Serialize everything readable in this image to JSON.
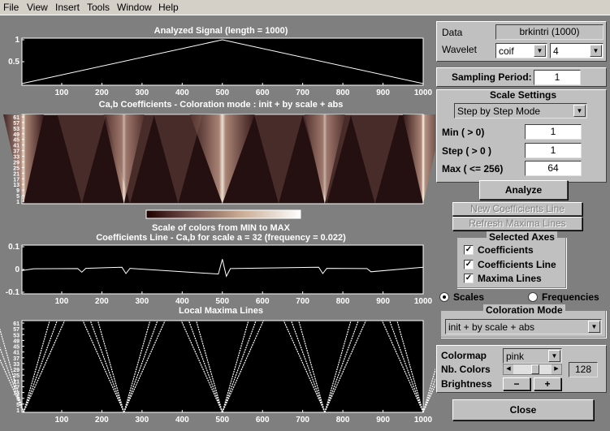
{
  "menu": [
    "File",
    "View",
    "Insert",
    "Tools",
    "Window",
    "Help"
  ],
  "plots": {
    "signal": {
      "title": "Analyzed Signal  (length = 1000)",
      "yticks": [
        "1",
        "0.5"
      ],
      "ytick_values": [
        1,
        0.5
      ],
      "ylim": [
        0,
        1
      ]
    },
    "coef": {
      "title": "Ca,b Coefficients  - Coloration mode : init + by scale + abs",
      "yticks": [
        "61",
        "57",
        "53",
        "49",
        "45",
        "41",
        "37",
        "33",
        "29",
        "25",
        "21",
        "17",
        "13",
        "9",
        "5",
        "1"
      ]
    },
    "colorbar": {
      "title": "Scale of colors from MIN to MAX"
    },
    "line": {
      "title": "Coefficients Line - Ca,b  for scale a = 32  (frequency =   0.022)",
      "yticks": [
        "0.1",
        "0",
        "-0.1"
      ],
      "ytick_values": [
        0.1,
        0,
        -0.1
      ],
      "ylim": [
        -0.1,
        0.1
      ]
    },
    "maxima": {
      "title": "Local Maxima Lines",
      "yticks": [
        "61",
        "57",
        "53",
        "49",
        "45",
        "41",
        "37",
        "33",
        "29",
        "25",
        "21",
        "17",
        "13",
        "9",
        "5",
        "1"
      ]
    },
    "xticks": [
      "100",
      "200",
      "300",
      "400",
      "500",
      "600",
      "700",
      "800",
      "900",
      "1000"
    ],
    "xtick_values": [
      100,
      200,
      300,
      400,
      500,
      600,
      700,
      800,
      900,
      1000
    ],
    "xlim": [
      1,
      1000
    ]
  },
  "signal_data": {
    "x": [
      1,
      500,
      1000
    ],
    "y": [
      0,
      1,
      0
    ]
  },
  "coef_line_data": {
    "x": [
      1,
      30,
      140,
      150,
      160,
      250,
      260,
      270,
      490,
      500,
      510,
      520,
      740,
      750,
      760,
      860,
      870,
      1000
    ],
    "y": [
      -0.005,
      0.003,
      0.004,
      -0.012,
      0.005,
      0.01,
      -0.018,
      0.005,
      -0.02,
      0.045,
      -0.03,
      0.004,
      0.01,
      -0.018,
      0.005,
      0.004,
      -0.01,
      0.01
    ]
  },
  "maxima_vertices": [
    5,
    255,
    500,
    755,
    1000
  ],
  "controls": {
    "data_label": "Data",
    "data_value": "brkintri  (1000)",
    "wavelet_label": "Wavelet",
    "wavelet_family": "coif",
    "wavelet_order": "4",
    "sampling_label": "Sampling Period:",
    "sampling_value": "1",
    "scale_settings_title": "Scale Settings",
    "scale_mode": "Step by Step Mode",
    "min_label": "Min  ( > 0)",
    "min_value": "1",
    "step_label": "Step ( > 0 )",
    "step_value": "1",
    "max_label": "Max  ( <= 256)",
    "max_value": "64",
    "analyze": "Analyze",
    "new_coef": "New Coefficients Line",
    "refresh_maxima": "Refresh Maxima Lines",
    "selected_axes_title": "Selected Axes",
    "axes": [
      {
        "label": "Coefficients",
        "checked": true
      },
      {
        "label": "Coefficients Line",
        "checked": true
      },
      {
        "label": "Maxima Lines",
        "checked": true
      }
    ],
    "scales_label": "Scales",
    "frequencies_label": "Frequencies",
    "coloration_title": "Coloration Mode",
    "coloration_value": "init + by scale + abs",
    "colormap_label": "Colormap",
    "colormap_value": "pink",
    "nbcolors_label": "Nb. Colors",
    "nbcolors_value": "128",
    "brightness_label": "Brightness",
    "minus": "−",
    "plus": "+",
    "close": "Close"
  },
  "colors": {
    "bg": "#7f7f7f",
    "panel": "#c0c0c0",
    "plot": "#000000",
    "menubar": "#d4d0c8"
  }
}
